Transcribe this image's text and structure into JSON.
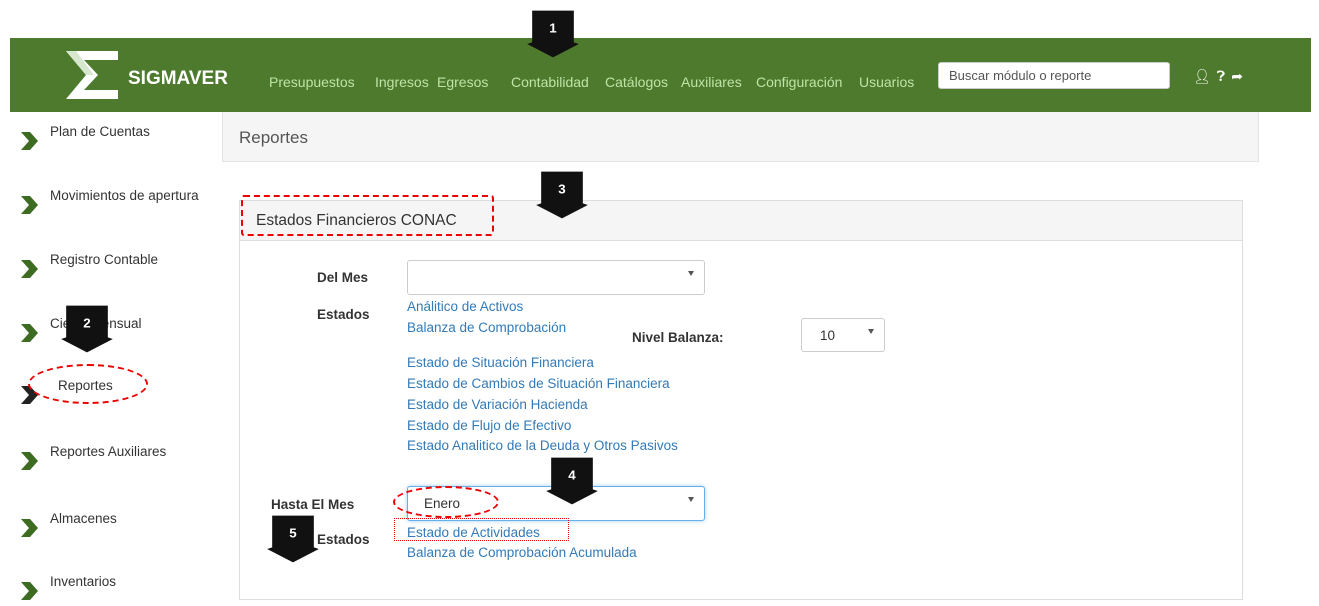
{
  "brand": {
    "name": "SIGMAVER"
  },
  "top_nav": [
    "Presupuestos",
    "Ingresos",
    "Egresos",
    "Contabilidad",
    "Catálogos",
    "Auxiliares",
    "Configuración",
    "Usuarios"
  ],
  "search": {
    "placeholder": "Buscar módulo o reporte"
  },
  "top_icons": [
    "user-icon",
    "help-icon",
    "logout-icon"
  ],
  "sidebar": {
    "items": [
      {
        "label": "Plan de Cuentas"
      },
      {
        "label": "Movimientos de apertura"
      },
      {
        "label": "Registro Contable"
      },
      {
        "label": "Cierre Mensual"
      },
      {
        "label": "Reportes"
      },
      {
        "label": "Reportes Auxiliares"
      },
      {
        "label": "Almacenes"
      },
      {
        "label": "Inventarios"
      }
    ]
  },
  "breadcrumb": {
    "title": "Reportes"
  },
  "section": {
    "title": "Estados Financieros CONAC",
    "del_mes": {
      "label": "Del Mes",
      "value": ""
    },
    "estados_label": "Estados",
    "reports_1": [
      "Análitico de Activos",
      "Balanza de Comprobación"
    ],
    "nivel_balanza": {
      "label": "Nivel Balanza:",
      "value": "10"
    },
    "reports_2": [
      "Estado de Situación Financiera",
      "Estado de Cambios de Situación Financiera",
      "Estado de Variación Hacienda",
      "Estado de Flujo de Efectivo",
      "Estado Analitico de la Deuda y Otros Pasivos"
    ],
    "hasta_mes": {
      "label": "Hasta El Mes",
      "value": "Enero"
    },
    "estados_label_2": "Estados",
    "reports_3": [
      "Estado de Actividades",
      "Balanza de Comprobación Acumulada"
    ]
  },
  "markers": [
    "1",
    "2",
    "3",
    "4",
    "5"
  ],
  "colors": {
    "topbar": "#4e7a2d",
    "nav_text": "#bfe3a6",
    "link": "#337ab7",
    "annotation": "#e00000",
    "sidebar_chevron": "#3e6b22"
  }
}
